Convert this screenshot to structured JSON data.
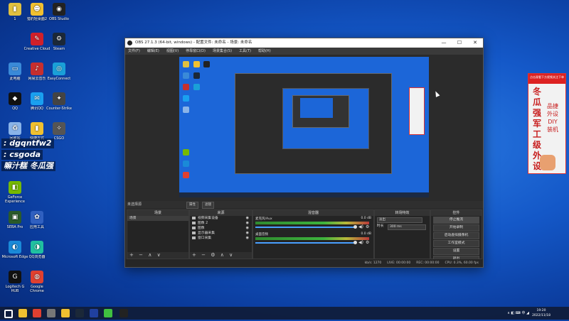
{
  "desktop": {
    "icons": [
      {
        "label": "1",
        "color": "#e0c040",
        "glyph": "▮"
      },
      {
        "label": "猎豹轻桌面2",
        "color": "#f0c030",
        "glyph": "☻"
      },
      {
        "label": "OBS Studio",
        "color": "#222222",
        "glyph": "◉"
      },
      {
        "label": "Creative Cloud",
        "color": "#d0202a",
        "glyph": "✎"
      },
      {
        "label": "Steam",
        "color": "#1b2838",
        "glyph": "⚙"
      },
      {
        "label": "此电脑",
        "color": "#3a8ad8",
        "glyph": "▭"
      },
      {
        "label": "网易云音乐",
        "color": "#c62f2f",
        "glyph": "♪"
      },
      {
        "label": "EasyConnect",
        "color": "#1aa0d8",
        "glyph": "◎"
      },
      {
        "label": "QQ",
        "color": "#111111",
        "glyph": "◆"
      },
      {
        "label": "腾讯QQ",
        "color": "#1aa0f0",
        "glyph": "✉"
      },
      {
        "label": "Counter-Strike",
        "color": "#444444",
        "glyph": "✦"
      },
      {
        "label": "回收站",
        "color": "#8ab4e8",
        "glyph": "♻"
      },
      {
        "label": "快捷方式",
        "color": "#f0c030",
        "glyph": "▮"
      },
      {
        "label": "CSGO",
        "color": "#555555",
        "glyph": "✧"
      },
      {
        "label": "GeForce Experience",
        "color": "#76b900",
        "glyph": "◧"
      },
      {
        "label": "SEBA Pro",
        "color": "#2a5a2a",
        "glyph": "▣"
      },
      {
        "label": "应用工具",
        "color": "#3060c0",
        "glyph": "✿"
      },
      {
        "label": "Microsoft Edge",
        "color": "#1a8ad8",
        "glyph": "◐"
      },
      {
        "label": "QQ浏览器",
        "color": "#20c0a0",
        "glyph": "◑"
      },
      {
        "label": "Logitech G HUB",
        "color": "#111111",
        "glyph": "G"
      },
      {
        "label": "Google Chrome",
        "color": "#e04030",
        "glyph": "◍"
      }
    ],
    "stamp_lines": [
      ": dgqntfw2",
      ": csgoda",
      "嘛汁糕 冬瓜强"
    ],
    "cursor": "pointer-icon"
  },
  "banner": {
    "top_text": "点击观看下方视频关注下单",
    "big_text": "冬瓜强军工级外设",
    "small_text": "品捷外设 DIY装机",
    "accent": "#c71d1d"
  },
  "obs": {
    "title": "OBS 27.1.3 (64-bit, windows) - 配置文件: 未命名 - 场景: 未命名",
    "window_buttons": [
      "—",
      "☐",
      "✕"
    ],
    "menu": [
      "文件(F)",
      "编辑(E)",
      "视图(V)",
      "停靠窗口(D)",
      "场景集合(S)",
      "工具(T)",
      "帮助(H)"
    ],
    "source_toolbar": {
      "label": "未选择源",
      "properties": "属性",
      "filters": "滤镜"
    },
    "scenes": {
      "header": "场景",
      "items": [
        "场景"
      ],
      "footer": [
        "+",
        "−",
        "∧",
        "∨"
      ]
    },
    "sources": {
      "header": "来源",
      "items": [
        "视频采集设备",
        "图像 2",
        "图像",
        "显示器采集",
        "窗口采集"
      ],
      "footer": [
        "+",
        "−",
        "⚙",
        "∧",
        "∨"
      ]
    },
    "mixer": {
      "header": "混音器",
      "channels": [
        {
          "name": "麦克风/Aux",
          "db": "0.0 dB"
        },
        {
          "name": "桌面音频",
          "db": "0.0 dB"
        }
      ]
    },
    "transitions": {
      "header": "转场特效",
      "type": "淡出",
      "duration_label": "时长",
      "duration": "300 ms"
    },
    "controls": {
      "header": "控件",
      "buttons": [
        "停止推流",
        "开始录制",
        "启动虚拟摄像机",
        "工作室模式",
        "设置",
        "退出"
      ]
    },
    "status": {
      "live_label": "LIVE: 00:00:00",
      "rec_label": "REC: 00:00:00",
      "cpu": "CPU: 0.3%, 60.00 fps",
      "bitrate": "kb/s: 1270"
    }
  },
  "taskbar": {
    "time": "19:20",
    "date": "2022/11/18",
    "tray": "∧ ◧ ⌨ 中 ◢",
    "apps": [
      {
        "name": "start",
        "color": "#ffffff"
      },
      {
        "name": "file-explorer",
        "color": "#f0c030"
      },
      {
        "name": "chrome",
        "color": "#e04030"
      },
      {
        "name": "csgo",
        "color": "#777777"
      },
      {
        "name": "miniapp",
        "color": "#f0c030"
      },
      {
        "name": "steam",
        "color": "#1b2838"
      },
      {
        "name": "sk",
        "color": "#2040a0"
      },
      {
        "name": "circle",
        "color": "#40c040"
      },
      {
        "name": "obs",
        "color": "#222222"
      }
    ]
  }
}
